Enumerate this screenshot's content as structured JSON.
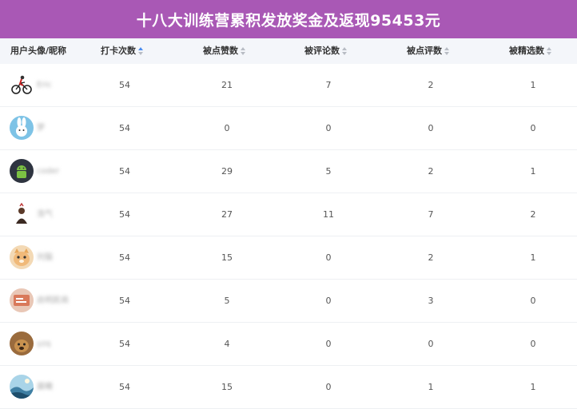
{
  "title": "十八大训练营累积发放奖金及返现95453元",
  "columns": [
    {
      "label": "用户头像/昵称",
      "sortable": false
    },
    {
      "label": "打卡次数",
      "sortable": true,
      "active": true
    },
    {
      "label": "被点赞数",
      "sortable": true
    },
    {
      "label": "被评论数",
      "sortable": true
    },
    {
      "label": "被点评数",
      "sortable": true
    },
    {
      "label": "被精选数",
      "sortable": true
    }
  ],
  "rows": [
    {
      "nickname": "Eric",
      "avatar": "cyclist-avatar-icon",
      "checkins": "54",
      "likes": "21",
      "comments": "7",
      "reviews": "2",
      "featured": "1"
    },
    {
      "nickname": "梦",
      "avatar": "rabbit-avatar-icon",
      "checkins": "54",
      "likes": "0",
      "comments": "0",
      "reviews": "0",
      "featured": "0"
    },
    {
      "nickname": "coder",
      "avatar": "android-avatar-icon",
      "checkins": "54",
      "likes": "29",
      "comments": "5",
      "reviews": "2",
      "featured": "1"
    },
    {
      "nickname": "浩气",
      "avatar": "figure-avatar-icon",
      "checkins": "54",
      "likes": "27",
      "comments": "11",
      "reviews": "7",
      "featured": "2"
    },
    {
      "nickname": "刘猫",
      "avatar": "cat-avatar-icon",
      "checkins": "54",
      "likes": "15",
      "comments": "0",
      "reviews": "2",
      "featured": "1"
    },
    {
      "nickname": "启明民商",
      "avatar": "card-avatar-icon",
      "checkins": "54",
      "likes": "5",
      "comments": "0",
      "reviews": "3",
      "featured": "0"
    },
    {
      "nickname": "yzq",
      "avatar": "animal-avatar-icon",
      "checkins": "54",
      "likes": "4",
      "comments": "0",
      "reviews": "0",
      "featured": "0"
    },
    {
      "nickname": "晨曦",
      "avatar": "landscape-avatar-icon",
      "checkins": "54",
      "likes": "15",
      "comments": "0",
      "reviews": "1",
      "featured": "1"
    }
  ],
  "colors": {
    "banner": "#a958b5",
    "sort_active": "#4a8cf0",
    "header_bg": "#f4f6fa"
  }
}
